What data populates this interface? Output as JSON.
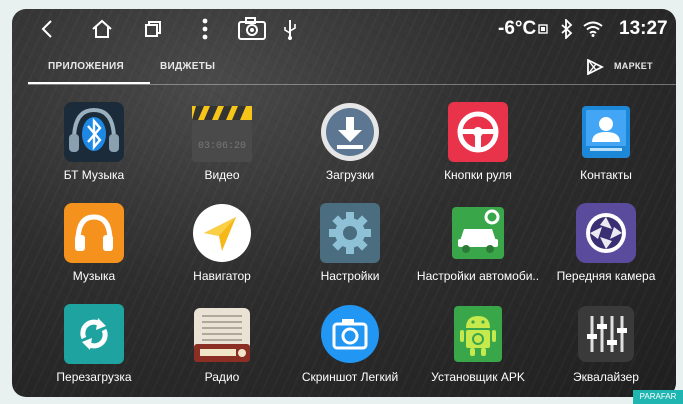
{
  "statusbar": {
    "temperature": "-6°C",
    "time": "13:27"
  },
  "tabs": {
    "apps": "ПРИЛОЖЕНИЯ",
    "widgets": "ВИДЖЕТЫ",
    "market": "МАРКЕТ"
  },
  "video_timecode": "03:06:20",
  "apps": [
    {
      "label": "БТ Музыка",
      "icon": "bluetooth-headphones-icon"
    },
    {
      "label": "Видео",
      "icon": "clapperboard-icon"
    },
    {
      "label": "Загрузки",
      "icon": "download-icon"
    },
    {
      "label": "Кнопки руля",
      "icon": "steering-wheel-icon"
    },
    {
      "label": "Контакты",
      "icon": "contacts-icon"
    },
    {
      "label": "Музыка",
      "icon": "headphones-icon"
    },
    {
      "label": "Навигатор",
      "icon": "navigator-arrow-icon"
    },
    {
      "label": "Настройки",
      "icon": "settings-gear-icon"
    },
    {
      "label": "Настройки автомоби..",
      "icon": "car-settings-icon"
    },
    {
      "label": "Передняя камера",
      "icon": "camera-aperture-icon"
    },
    {
      "label": "Перезагрузка",
      "icon": "reload-icon"
    },
    {
      "label": "Радио",
      "icon": "radio-icon"
    },
    {
      "label": "Скриншот Легкий",
      "icon": "screenshot-camera-icon"
    },
    {
      "label": "Установщик APK",
      "icon": "android-installer-icon"
    },
    {
      "label": "Эквалайзер",
      "icon": "equalizer-icon"
    }
  ],
  "watermark": "PARAFAR",
  "colors": {
    "bt_bg": "#1b2b3a",
    "clapper": "#4a4a4a",
    "download": "#5d7793",
    "steering": "#e8334a",
    "contacts": "#1e88d8",
    "music": "#f5921e",
    "nav": "#ffffff",
    "settings": "#4a6e80",
    "car": "#3aa64a",
    "camera": "#5b4b9c",
    "reload": "#1fa3a0",
    "radio": "#e9e2d5",
    "screenshot": "#2196f3",
    "apk": "#3aa64a",
    "eq": "#3a3a3a"
  }
}
